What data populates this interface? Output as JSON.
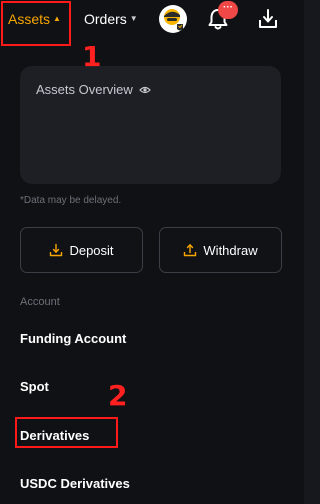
{
  "topbar": {
    "assets_label": "Assets",
    "orders_label": "Orders",
    "caret_up": "▲",
    "caret_down": "▼",
    "notification_badge": "···"
  },
  "overview": {
    "title": "Assets Overview",
    "note": "*Data may be delayed."
  },
  "actions": {
    "deposit_label": "Deposit",
    "withdraw_label": "Withdraw"
  },
  "account": {
    "section_label": "Account",
    "items": [
      {
        "label": "Funding Account"
      },
      {
        "label": "Spot"
      },
      {
        "label": "Derivatives"
      },
      {
        "label": "USDC Derivatives"
      }
    ]
  },
  "annotations": {
    "step1": "1",
    "step2": "2"
  },
  "colors": {
    "accent": "#f7a600",
    "annotation": "#ff1a1a",
    "badge": "#f04747"
  },
  "icons": [
    "avatar-icon",
    "bell-icon",
    "download-icon",
    "eye-icon",
    "deposit-icon",
    "withdraw-icon"
  ]
}
